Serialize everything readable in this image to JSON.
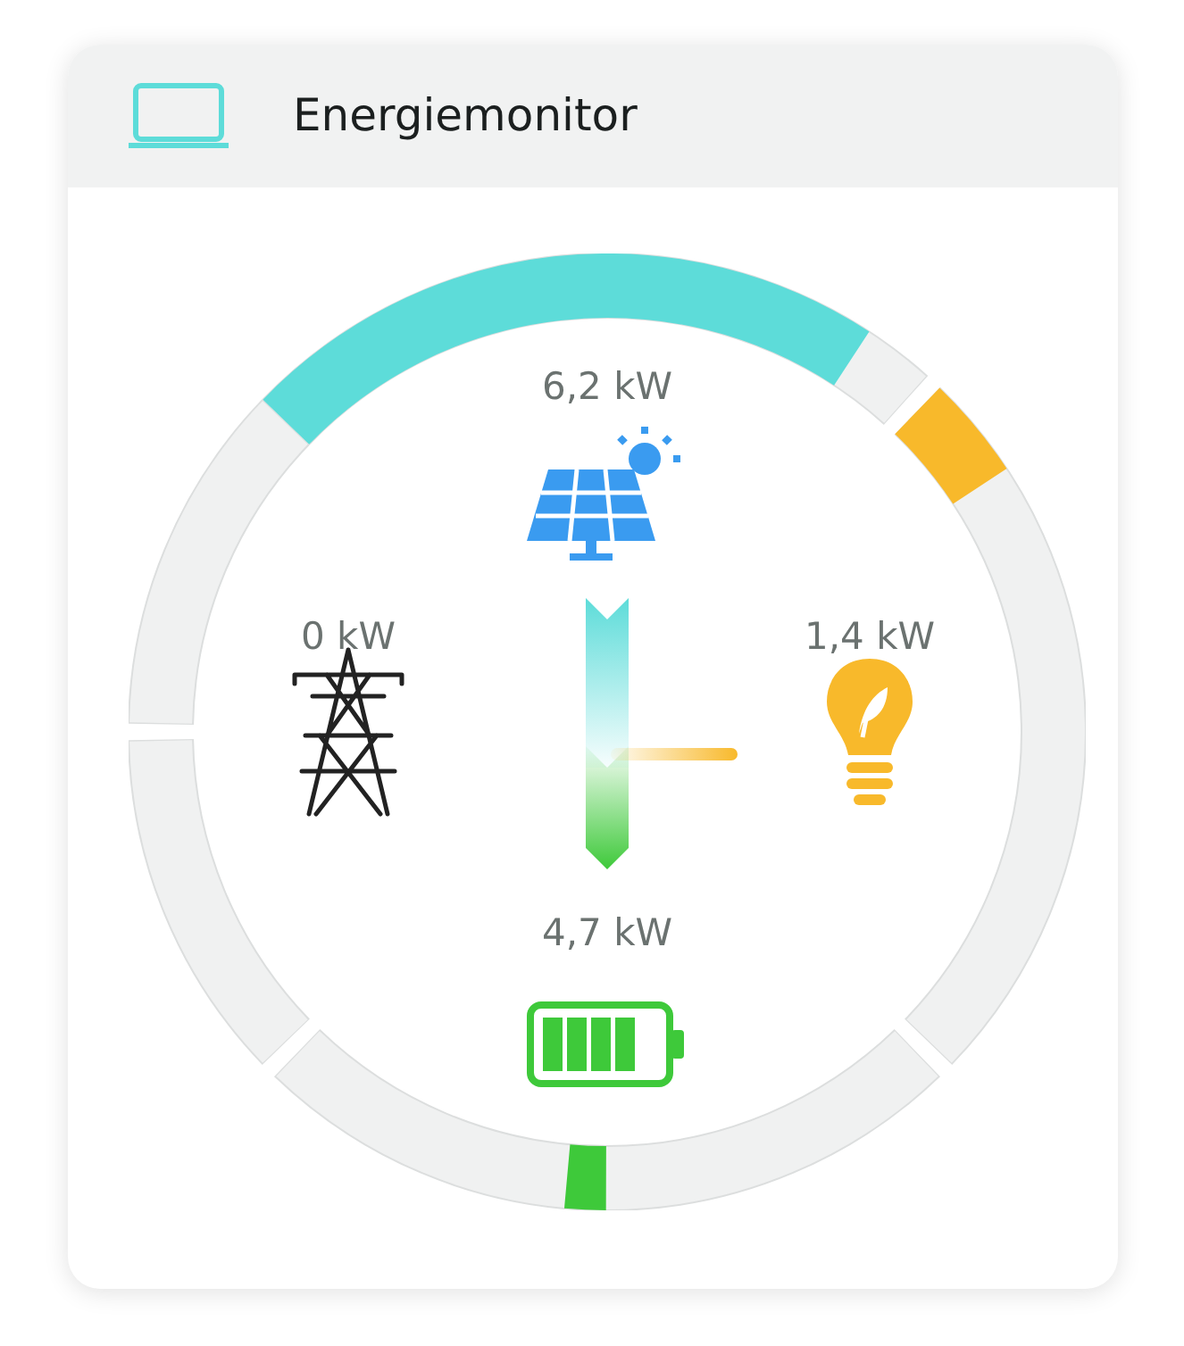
{
  "header": {
    "title": "Energiemonitor"
  },
  "nodes": [
    {
      "kind": "solar",
      "reading": "6,2 kW"
    },
    {
      "kind": "grid",
      "reading": "0 kW"
    },
    {
      "kind": "consumption",
      "reading": "1,4 kW"
    },
    {
      "kind": "battery",
      "reading": "4,7 kW",
      "level": 0.8
    }
  ],
  "ring": [
    {
      "kind": "fill",
      "color": "#5ddcd9"
    },
    {
      "kind": "fill",
      "color": "#f8b92b"
    },
    {
      "kind": "marker",
      "color": "#3ec93a"
    },
    {
      "kind": "empty"
    },
    {
      "kind": "empty"
    }
  ]
}
